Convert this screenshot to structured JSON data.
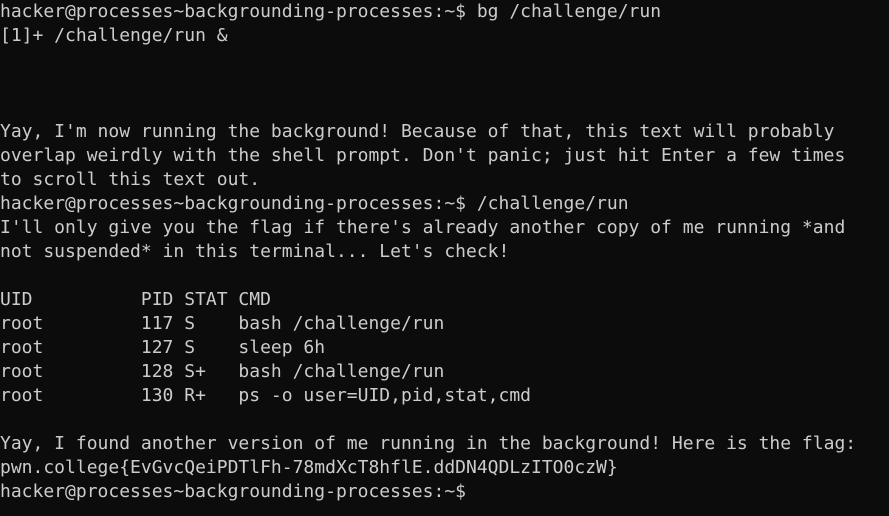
{
  "terminal": {
    "lines": [
      "hacker@processes~backgrounding-processes:~$ bg /challenge/run",
      "[1]+ /challenge/run &",
      "",
      "",
      "",
      "Yay, I'm now running the background! Because of that, this text will probably",
      "overlap weirdly with the shell prompt. Don't panic; just hit Enter a few times",
      "to scroll this text out.",
      "hacker@processes~backgrounding-processes:~$ /challenge/run",
      "I'll only give you the flag if there's already another copy of me running *and",
      "not suspended* in this terminal... Let's check!",
      "",
      "UID          PID STAT CMD",
      "root         117 S    bash /challenge/run",
      "root         127 S    sleep 6h",
      "root         128 S+   bash /challenge/run",
      "root         130 R+   ps -o user=UID,pid,stat,cmd",
      "",
      "Yay, I found another version of me running in the background! Here is the flag:",
      "pwn.college{EvGvcQeiPDTlFh-78mdXcT8hflE.ddDN4QDLzITO0czW}",
      "hacker@processes~backgrounding-processes:~$ "
    ]
  }
}
